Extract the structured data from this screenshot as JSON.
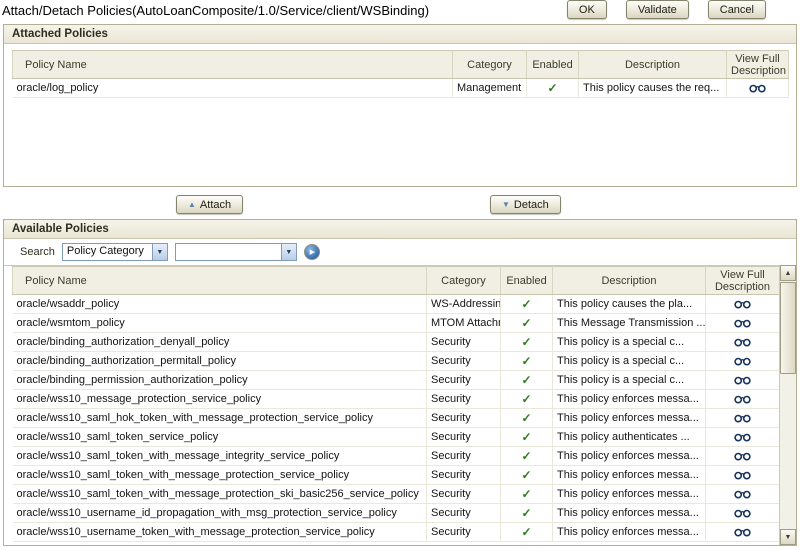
{
  "title": "Attach/Detach Policies(AutoLoanComposite/1.0/Service/client/WSBinding)",
  "toolbar": {
    "ok": "OK",
    "validate": "Validate",
    "cancel": "Cancel"
  },
  "actions": {
    "attach": "Attach",
    "detach": "Detach"
  },
  "attached": {
    "header": "Attached Policies",
    "columns": [
      "Policy Name",
      "Category",
      "Enabled",
      "Description",
      "View Full Description"
    ],
    "rows": [
      {
        "name": "oracle/log_policy",
        "category": "Management",
        "enabled": true,
        "description": "This policy causes the req..."
      }
    ]
  },
  "available": {
    "header": "Available Policies",
    "search": {
      "label": "Search",
      "category_value": "Policy Category",
      "term_value": "",
      "go_icon": "go-arrow-icon"
    },
    "columns": [
      "Policy Name",
      "Category",
      "Enabled",
      "Description",
      "View Full Description"
    ],
    "rows": [
      {
        "name": "oracle/wsaddr_policy",
        "category": "WS-Addressing",
        "enabled": true,
        "description": "This policy causes the pla..."
      },
      {
        "name": "oracle/wsmtom_policy",
        "category": "MTOM Attachments",
        "enabled": true,
        "description": "This Message Transmission ..."
      },
      {
        "name": "oracle/binding_authorization_denyall_policy",
        "category": "Security",
        "enabled": true,
        "description": "This policy is a special c..."
      },
      {
        "name": "oracle/binding_authorization_permitall_policy",
        "category": "Security",
        "enabled": true,
        "description": "This policy is a special c..."
      },
      {
        "name": "oracle/binding_permission_authorization_policy",
        "category": "Security",
        "enabled": true,
        "description": "This policy is a special c..."
      },
      {
        "name": "oracle/wss10_message_protection_service_policy",
        "category": "Security",
        "enabled": true,
        "description": "This policy enforces messa..."
      },
      {
        "name": "oracle/wss10_saml_hok_token_with_message_protection_service_policy",
        "category": "Security",
        "enabled": true,
        "description": "This policy enforces messa..."
      },
      {
        "name": "oracle/wss10_saml_token_service_policy",
        "category": "Security",
        "enabled": true,
        "description": "This policy authenticates ..."
      },
      {
        "name": "oracle/wss10_saml_token_with_message_integrity_service_policy",
        "category": "Security",
        "enabled": true,
        "description": "This policy enforces messa..."
      },
      {
        "name": "oracle/wss10_saml_token_with_message_protection_service_policy",
        "category": "Security",
        "enabled": true,
        "description": "This policy enforces messa..."
      },
      {
        "name": "oracle/wss10_saml_token_with_message_protection_ski_basic256_service_policy",
        "category": "Security",
        "enabled": true,
        "description": "This policy enforces messa..."
      },
      {
        "name": "oracle/wss10_username_id_propagation_with_msg_protection_service_policy",
        "category": "Security",
        "enabled": true,
        "description": "This policy enforces messa..."
      },
      {
        "name": "oracle/wss10_username_token_with_message_protection_service_policy",
        "category": "Security",
        "enabled": true,
        "description": "This policy enforces messa..."
      }
    ]
  },
  "icons": {
    "enabled": "check-icon",
    "view_full_description": "glasses-icon",
    "attach": "triangle-up-icon",
    "detach": "triangle-down-icon"
  },
  "colors": {
    "accent_blue": "#3f69a0",
    "check_green": "#2f7a1f",
    "panel_border": "#b3ae93",
    "header_beige": "#f1efe3",
    "go_button_blue": "#2f6ab0"
  }
}
